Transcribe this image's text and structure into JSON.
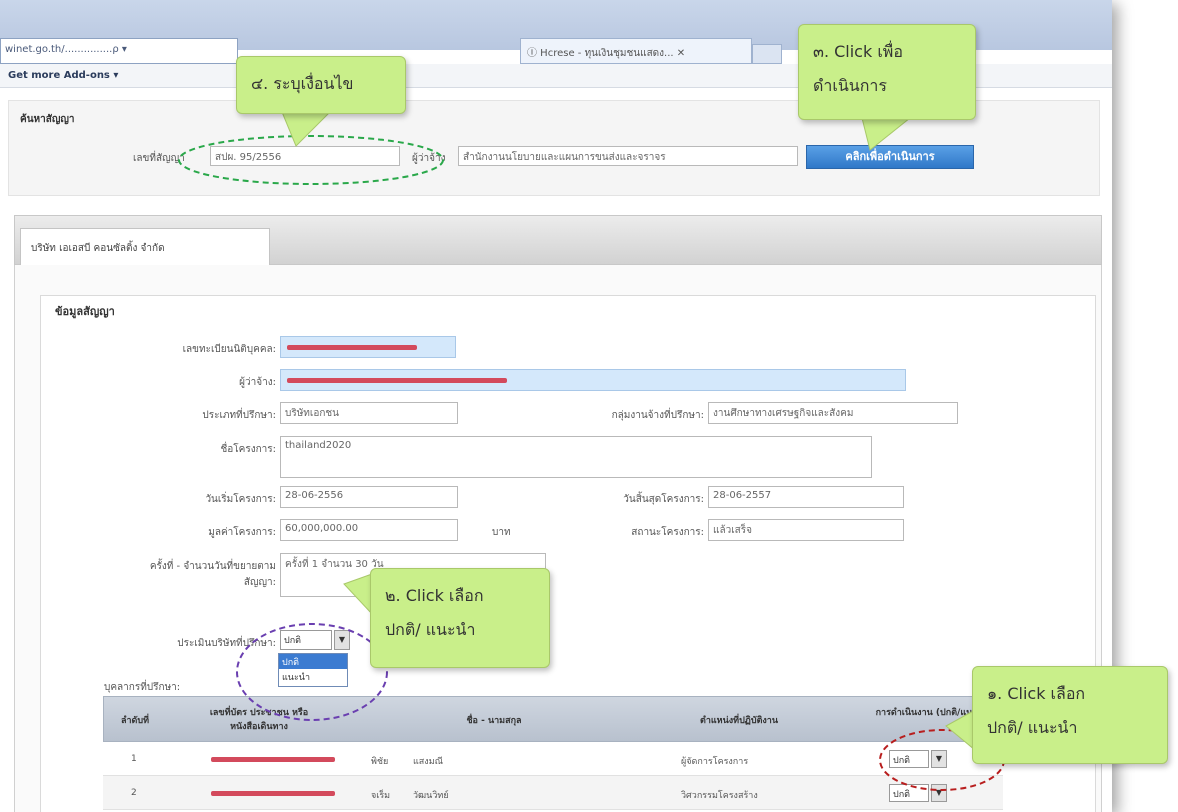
{
  "browser": {
    "address_text": "winet.go.th/...............ρ  ▾",
    "tab_label": "Ⓘ  Hcrese - ทุนเงินชุมชนแสดง... ✕",
    "command_bar_label": "Get more Add-ons ▾"
  },
  "search": {
    "section_title": "ค้นหาสัญญา",
    "contract_no_label": "เลขที่สัญญา",
    "contract_no_value": "สปผ. 95/2556",
    "employer_label": "ผู้ว่าจ้าง",
    "employer_value": "สำนักงานนโยบายและแผนการขนส่งและจราจร",
    "process_button": "คลิกเพื่อดำเนินการ"
  },
  "company_tab": "บริษัท เอเอสบี คอนซัลติ้ง จำกัด",
  "contract_info": {
    "title": "ข้อมูลสัญญา",
    "juristic_id_label": "เลขทะเบียนนิติบุคคล:",
    "employer_label": "ผู้ว่าจ้าง:",
    "consult_type_label": "ประเภทที่ปรึกษา:",
    "consult_type_value": "บริษัทเอกชน",
    "work_group_label": "กลุ่มงานจ้างที่ปรึกษา:",
    "work_group_value": "งานศึกษาทางเศรษฐกิจและสังคม",
    "project_name_label": "ชื่อโครงการ:",
    "project_name_value": "thailand2020",
    "start_date_label": "วันเริ่มโครงการ:",
    "start_date_value": "28-06-2556",
    "end_date_label": "วันสิ้นสุดโครงการ:",
    "end_date_value": "28-06-2557",
    "project_value_label": "มูลค่าโครงการ:",
    "project_value_value": "60,000,000.00",
    "currency_unit": "บาท",
    "status_label": "สถานะโครงการ:",
    "status_value": "แล้วเสร็จ",
    "extension_label_1": "ครั้งที่ - จำนวนวันที่ขยายตาม",
    "extension_label_2": "สัญญา:",
    "extension_value": "ครั้งที่ 1 จำนวน 30 วัน",
    "company_eval_label": "ประเมินบริษัทที่ปรึกษา:",
    "company_eval_selected": "ปกติ",
    "dropdown_options": [
      "ปกติ",
      "แนะนำ"
    ],
    "consultant_label": "บุคลากรที่ปรึกษา:"
  },
  "table": {
    "headers": [
      "ลำดับที่",
      "เลขที่บัตร ประชาชน หรือ หนังสือเดินทาง",
      "ชื่อ - นามสกุล",
      "ตำแหน่งที่ปฏิบัติงาน",
      "การดำเนินงาน (ปกติ/แนะนำ)"
    ],
    "rows": [
      {
        "no": "1",
        "first": "พิชัย",
        "last": "แสงมณี",
        "position": "ผู้จัดการโครงการ",
        "eval": "ปกติ"
      },
      {
        "no": "2",
        "first": "จเร็ม",
        "last": "วัฒนวิทย์",
        "position": "วิศวกรรมโครงสร้าง",
        "eval": "ปกติ"
      }
    ]
  },
  "callouts": {
    "step1_line1": "๑.  Click เลือก",
    "step1_line2": "ปกติ/ แนะนำ",
    "step2_line1": "๒.  Click เลือก",
    "step2_line2": "ปกติ/ แนะนำ",
    "step3_line1": "๓.  Click เพื่อ",
    "step3_line2": "ดำเนินการ",
    "step4_line1": "๔.  ระบุเงื่อนไข"
  },
  "colors": {
    "callout_fill": "#c9ef8a",
    "process_button": "#2f78c8",
    "highlight_field": "#d4e8fb",
    "green_dash": "#2aa84a",
    "purple_dash": "#6a3fb0",
    "red_dash": "#b81e1e"
  }
}
